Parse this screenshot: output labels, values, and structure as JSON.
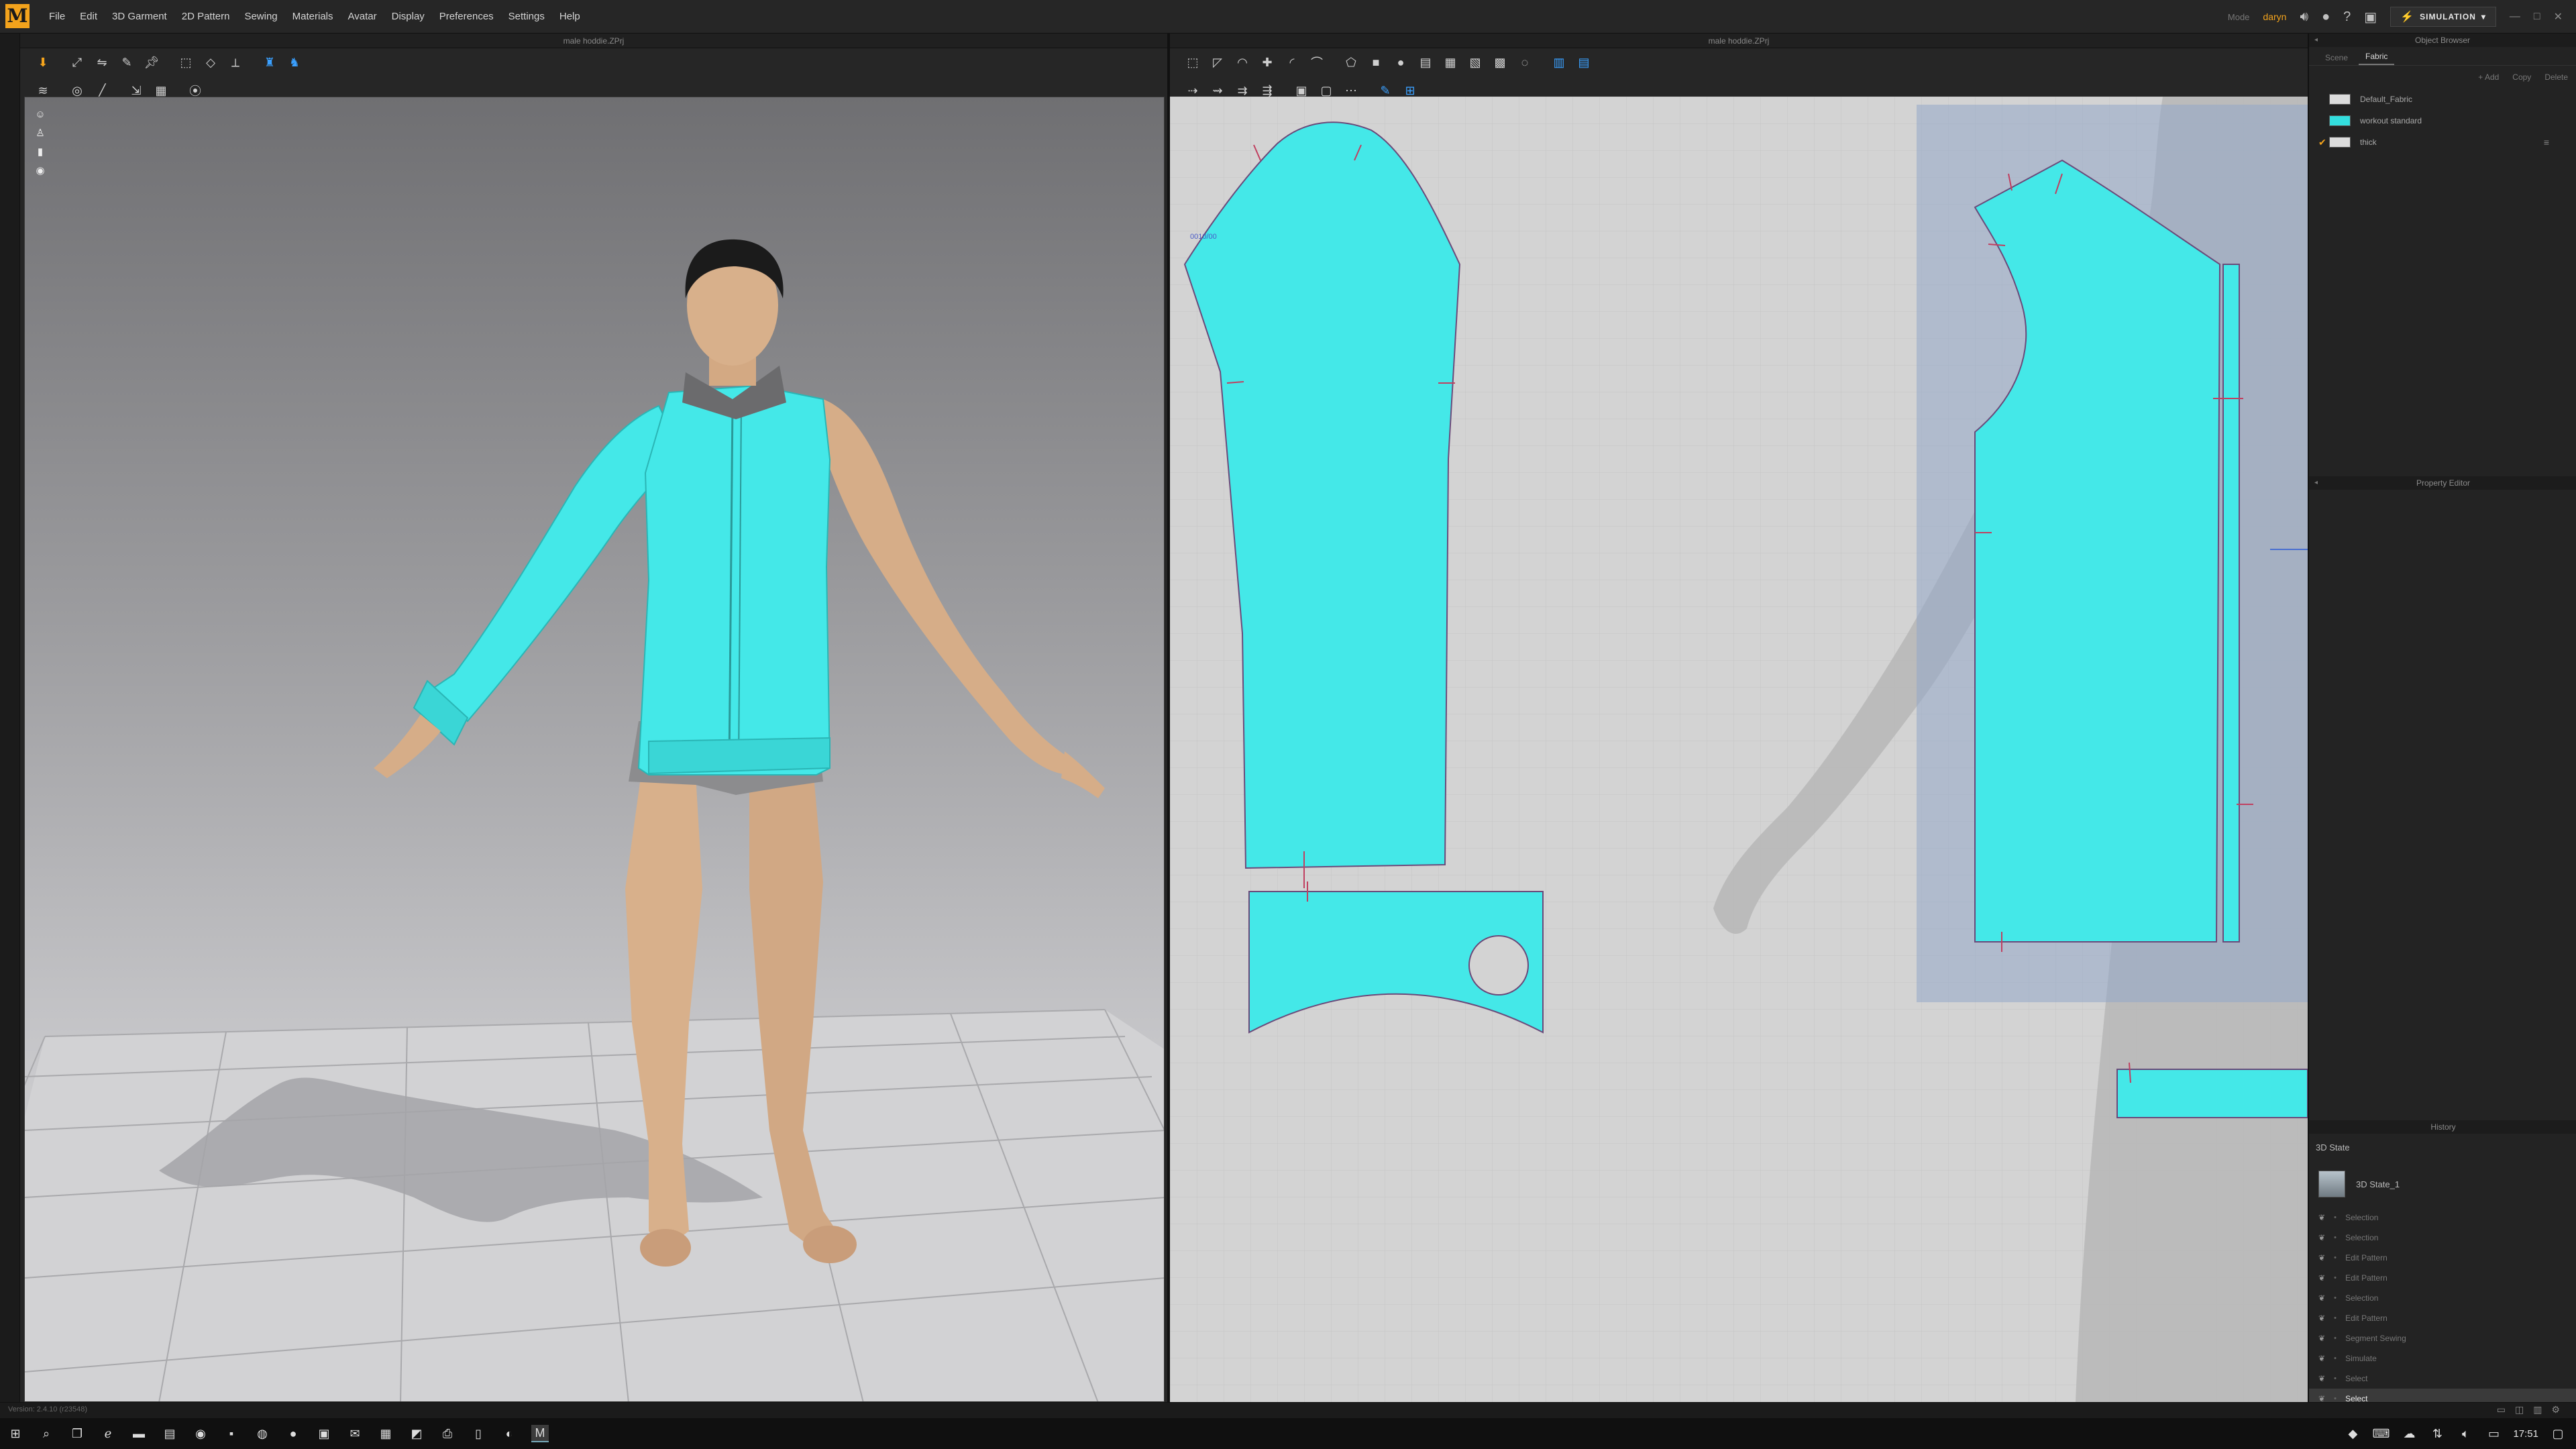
{
  "app": {
    "logo": "M",
    "menu": [
      "File",
      "Edit",
      "3D Garment",
      "2D Pattern",
      "Sewing",
      "Materials",
      "Avatar",
      "Display",
      "Preferences",
      "Settings",
      "Help"
    ],
    "user_mode": "Mode",
    "user_name": "daryn",
    "simulation_label": "SIMULATION"
  },
  "panel_3d": {
    "file_title": "male hoddie.ZPrj"
  },
  "panel_2d": {
    "file_title": "male hoddie.ZPrj",
    "piece_label": "0010/00"
  },
  "object_browser": {
    "title": "Object Browser",
    "tabs": [
      "Scene",
      "Fabric"
    ],
    "active_tab": "Fabric",
    "actions": [
      "+ Add",
      "Copy",
      "Delete"
    ],
    "fabrics": [
      {
        "name": "Default_Fabric",
        "color": "#dcdcdc",
        "checked": false
      },
      {
        "name": "workout standard",
        "color": "#33dede",
        "checked": false
      },
      {
        "name": "thick",
        "color": "#dcdcdc",
        "checked": true
      }
    ]
  },
  "property_editor": {
    "title": "Property Editor"
  },
  "history": {
    "title": "History",
    "state_label": "3D State",
    "snapshot_label": "3D State_1",
    "items": [
      {
        "label": "Selection",
        "current": false
      },
      {
        "label": "Selection",
        "current": false
      },
      {
        "label": "Edit Pattern",
        "current": false
      },
      {
        "label": "Edit Pattern",
        "current": false
      },
      {
        "label": "Selection",
        "current": false
      },
      {
        "label": "Edit Pattern",
        "current": false
      },
      {
        "label": "Segment Sewing",
        "current": false
      },
      {
        "label": "Simulate",
        "current": false
      },
      {
        "label": "Select",
        "current": false
      },
      {
        "label": "Select",
        "current": true
      }
    ]
  },
  "status": {
    "version": "Version: 2.4.10    (r23548)"
  },
  "taskbar": {
    "clock": "17:51"
  },
  "colors": {
    "garment": "#44e8e8",
    "accent": "#f3a31c",
    "viewport_2d_bg": "#d3d3d3"
  }
}
